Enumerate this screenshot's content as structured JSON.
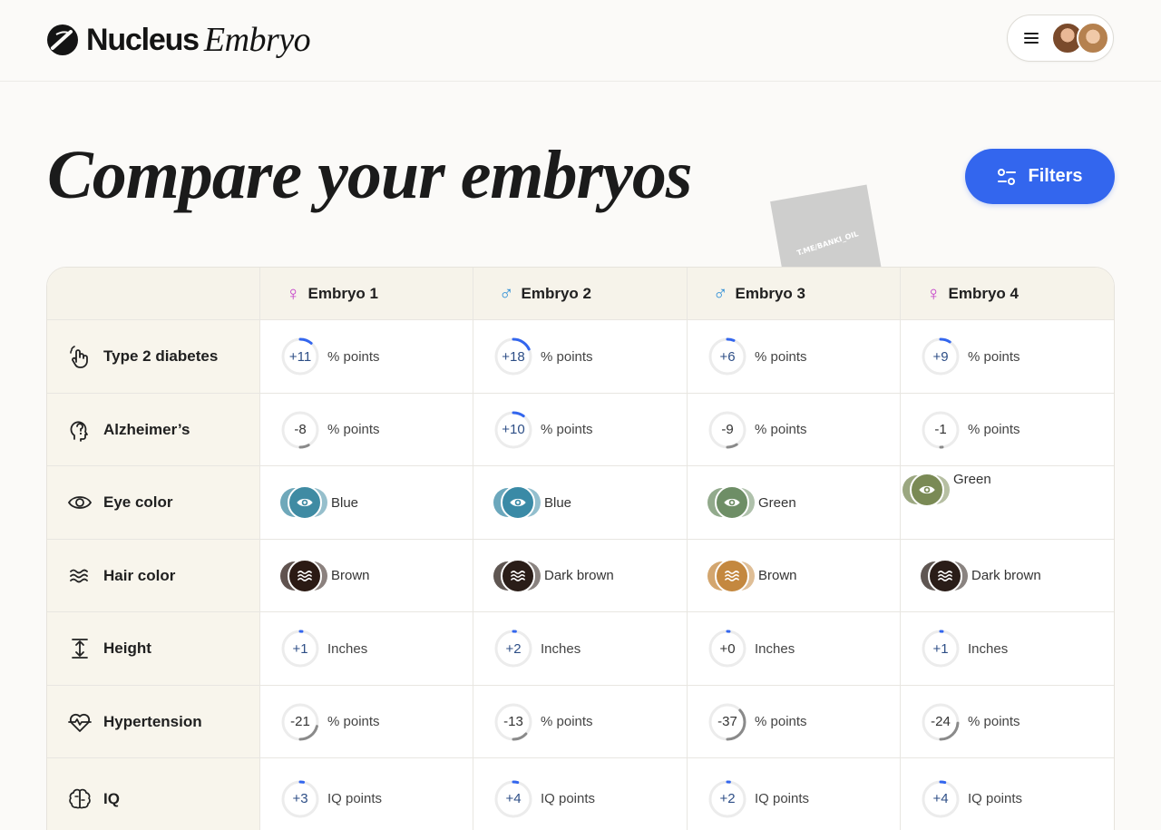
{
  "brand": {
    "name": "Nucleus",
    "product": "Embryo"
  },
  "header": {
    "menu_icon": "hamburger-icon"
  },
  "page": {
    "title": "Compare your embryos",
    "filters_label": "Filters",
    "watermark": "T.ME/BANKI_OIL"
  },
  "embryos": [
    {
      "name": "Embryo 1",
      "sex": "female",
      "sex_symbol": "♀"
    },
    {
      "name": "Embryo 2",
      "sex": "male",
      "sex_symbol": "♂"
    },
    {
      "name": "Embryo 3",
      "sex": "male",
      "sex_symbol": "♂"
    },
    {
      "name": "Embryo 4",
      "sex": "female",
      "sex_symbol": "♀"
    }
  ],
  "rows": [
    {
      "label": "Type 2 diabetes",
      "icon": "hand-tap-icon",
      "kind": "dial",
      "unit": "% points",
      "values": [
        "+11",
        "+18",
        "+6",
        "+9"
      ],
      "magnitudes": [
        11,
        18,
        6,
        9
      ]
    },
    {
      "label": "Alzheimer’s",
      "icon": "head-question-icon",
      "kind": "dial",
      "unit": "% points",
      "values": [
        "-8",
        "+10",
        "-9",
        "-1"
      ],
      "magnitudes": [
        -8,
        10,
        -9,
        -1
      ]
    },
    {
      "label": "Eye color",
      "icon": "eye-icon",
      "kind": "swatch",
      "values": [
        "Blue",
        "Blue",
        "Green",
        "Green"
      ],
      "colors": [
        "#3f8ba3",
        "#3a8aa6",
        "#6e8e66",
        "#7a8a55"
      ],
      "swatch_icon": "eye-icon"
    },
    {
      "label": "Hair color",
      "icon": "waves-icon",
      "kind": "swatch",
      "values": [
        "Brown",
        "Dark brown",
        "Brown",
        "Dark brown"
      ],
      "colors": [
        "#2b1a14",
        "#2a1d18",
        "#c4883f",
        "#2a1d18"
      ],
      "swatch_icon": "waves-icon"
    },
    {
      "label": "Height",
      "icon": "height-icon",
      "kind": "dial",
      "unit": "Inches",
      "values": [
        "+1",
        "+2",
        "+0",
        "+1"
      ],
      "magnitudes": [
        1,
        2,
        0,
        1
      ]
    },
    {
      "label": "Hypertension",
      "icon": "heartbeat-icon",
      "kind": "dial",
      "unit": "% points",
      "values": [
        "-21",
        "-13",
        "-37",
        "-24"
      ],
      "magnitudes": [
        -21,
        -13,
        -37,
        -24
      ]
    },
    {
      "label": "IQ",
      "icon": "brain-icon",
      "kind": "dial",
      "unit": "IQ points",
      "values": [
        "+3",
        "+4",
        "+2",
        "+4"
      ],
      "magnitudes": [
        3,
        4,
        2,
        4
      ]
    }
  ],
  "colors": {
    "accent": "#3366ee",
    "positive_arc": "#3366ee",
    "negative_arc": "#8a8a8a",
    "track": "#ececec"
  }
}
